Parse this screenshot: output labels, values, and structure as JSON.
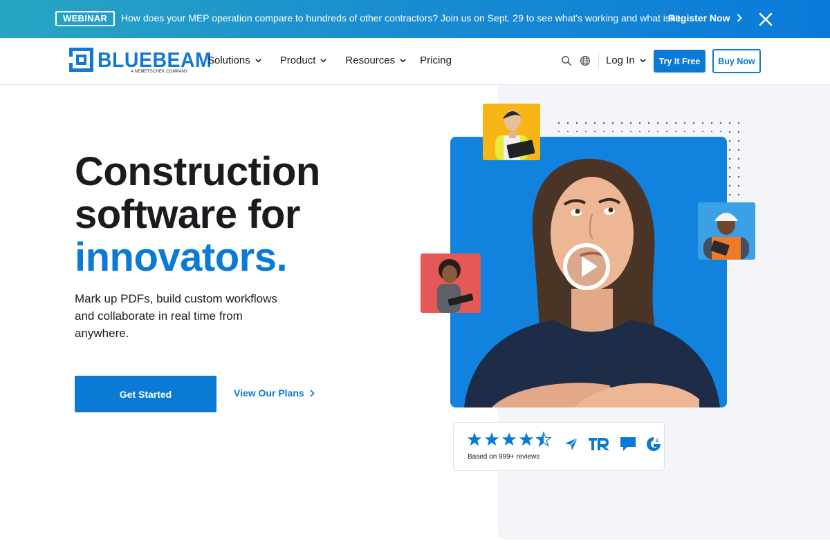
{
  "banner": {
    "badge": "WEBINAR",
    "text": "How does your MEP operation compare to hundreds of other contractors? Join us on Sept. 29 to see what's working and what isn't.",
    "cta": "Register Now",
    "close_icon": "close-icon"
  },
  "header": {
    "logo_text": "BLUEBEAM",
    "logo_subtext": "A NEMETSCHEK COMPANY",
    "nav": [
      {
        "label": "Solutions",
        "has_dropdown": true
      },
      {
        "label": "Product",
        "has_dropdown": true
      },
      {
        "label": "Resources",
        "has_dropdown": true
      },
      {
        "label": "Pricing",
        "has_dropdown": false
      }
    ],
    "login_label": "Log In",
    "try_label": "Try It Free",
    "buy_label": "Buy Now"
  },
  "hero": {
    "title_line1": "Construction",
    "title_line2": "software for",
    "title_highlight": "innovators.",
    "subtitle": "Mark up PDFs, build custom workflows and collaborate in real time from anywhere.",
    "cta_primary": "Get Started",
    "cta_secondary": "View Our Plans"
  },
  "reviews": {
    "rating": 4.5,
    "max_rating": 5,
    "text": "Based on 999+ reviews",
    "sources": [
      "capterra-icon",
      "trustradius-icon",
      "software-advice-icon",
      "g2-icon"
    ]
  },
  "colors": {
    "brand": "#0b7ad4",
    "banner_start": "#27a6c2",
    "banner_end": "#0a7ad9",
    "thumb_yellow": "#f7b516",
    "thumb_blue": "#3aa1e6",
    "thumb_red": "#e55858"
  }
}
